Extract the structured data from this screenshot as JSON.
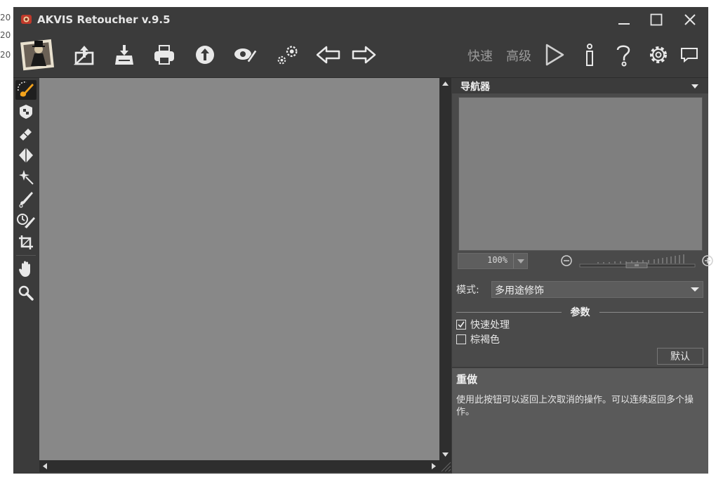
{
  "gutter": [
    "20",
    "20",
    "20"
  ],
  "app": {
    "title": "AKVIS Retoucher v.9.5"
  },
  "toolbar": {
    "icons": [
      "open-image-icon",
      "save-image-icon",
      "print-icon",
      "share-icon",
      "batch-icon",
      "settings-icon",
      "undo-arrow-icon",
      "redo-arrow-icon"
    ],
    "mode_quick": "快速",
    "mode_advanced": "高级"
  },
  "left_tools": [
    "retouch-brush-icon",
    "stamp-icon",
    "eraser-icon",
    "rubber-icon",
    "magic-icon",
    "smudge-brush-icon",
    "history-brush-icon",
    "crop-icon",
    "hand-icon",
    "zoom-icon"
  ],
  "navigator": {
    "title": "导航器",
    "zoom": "100%"
  },
  "settings": {
    "mode_label": "模式:",
    "mode_value": "多用途修饰",
    "params_title": "参数",
    "fast_processing": "快速处理",
    "sepia": "棕褐色",
    "fast_processing_checked": true,
    "sepia_checked": false,
    "default_button": "默认"
  },
  "hint": {
    "title": "重做",
    "text": "使用此按钮可以返回上次取消的操作。可以连续返回多个操作。"
  },
  "colors": {
    "window_bg": "#3b3b3b",
    "canvas_bg": "#888888",
    "panel_bg": "#4a4a4a",
    "icon": "#e8e8e8"
  }
}
